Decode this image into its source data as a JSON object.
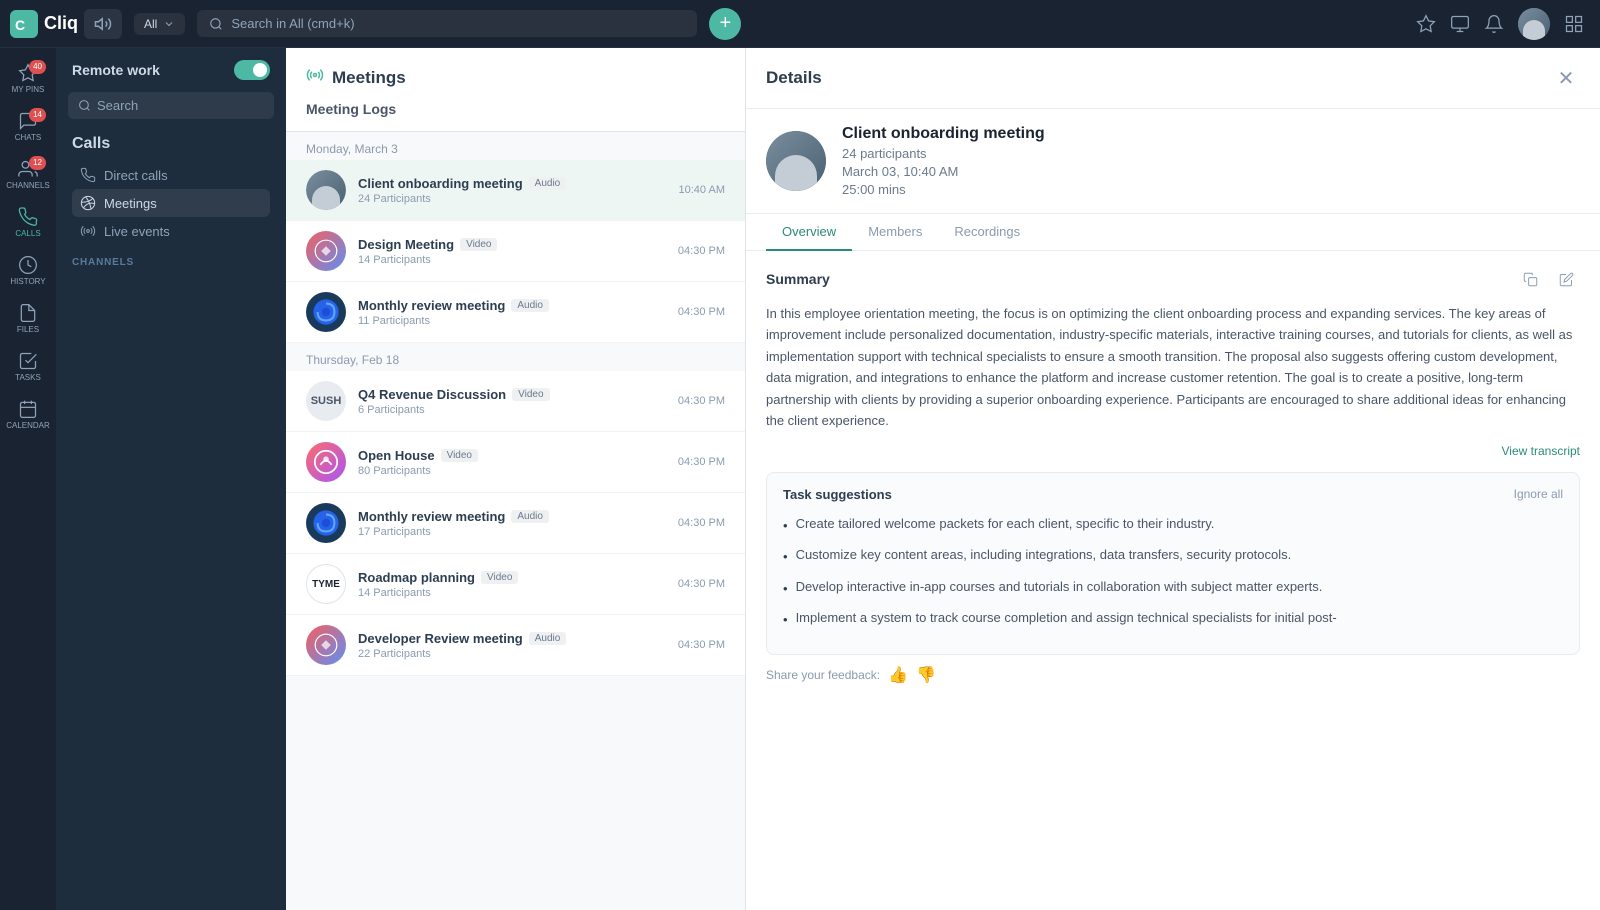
{
  "app": {
    "name": "Cliq",
    "workspace": "Remote work",
    "search_placeholder": "Search in All (cmd+k)",
    "all_label": "All"
  },
  "topbar": {
    "audio_label": "🔊",
    "add_btn": "+",
    "close_label": "×"
  },
  "sidebar": {
    "search_label": "Search",
    "calls_title": "Calls",
    "nav_items": [
      {
        "id": "direct-calls",
        "label": "Direct calls"
      },
      {
        "id": "meetings",
        "label": "Meetings"
      },
      {
        "id": "live-events",
        "label": "Live events"
      }
    ],
    "channels_label": "CHANNELS"
  },
  "icon_bar": {
    "items": [
      {
        "id": "my-pins",
        "label": "MY PINS",
        "badge": "40"
      },
      {
        "id": "chats",
        "label": "CHATS",
        "badge": "14"
      },
      {
        "id": "channels",
        "label": "CHANNELS",
        "badge": "12"
      },
      {
        "id": "calls",
        "label": "CALLS",
        "active": true
      },
      {
        "id": "history",
        "label": "HISTORY"
      },
      {
        "id": "files",
        "label": "FILES"
      },
      {
        "id": "tasks",
        "label": "TASKS"
      },
      {
        "id": "calendar",
        "label": "CALENDAR"
      }
    ]
  },
  "meetings_panel": {
    "title": "Meetings",
    "subtitle": "Meeting Logs",
    "dates": [
      {
        "label": "Monday, March 3",
        "meetings": [
          {
            "id": "client-onboarding",
            "name": "Client onboarding meeting",
            "tag": "Audio",
            "participants": "24 Participants",
            "time": "10:40 AM",
            "active": true
          },
          {
            "id": "design-meeting",
            "name": "Design Meeting",
            "tag": "Video",
            "participants": "14 Participants",
            "time": "04:30 PM"
          },
          {
            "id": "monthly-review-1",
            "name": "Monthly review meeting",
            "tag": "Audio",
            "participants": "11 Participants",
            "time": "04:30 PM"
          }
        ]
      },
      {
        "label": "Thursday, Feb 18",
        "meetings": [
          {
            "id": "q4-revenue",
            "name": "Q4 Revenue Discussion",
            "tag": "Video",
            "participants": "6 Participants",
            "time": "04:30 PM"
          },
          {
            "id": "open-house",
            "name": "Open House",
            "tag": "Video",
            "participants": "80 Participants",
            "time": "04:30 PM"
          },
          {
            "id": "monthly-review-2",
            "name": "Monthly review meeting",
            "tag": "Audio",
            "participants": "17 Participants",
            "time": "04:30 PM"
          },
          {
            "id": "roadmap-planning",
            "name": "Roadmap planning",
            "tag": "Video",
            "participants": "14 Participants",
            "time": "04:30 PM"
          },
          {
            "id": "developer-review",
            "name": "Developer Review meeting",
            "tag": "Audio",
            "participants": "22 Participants",
            "time": "04:30 PM"
          }
        ]
      }
    ]
  },
  "details_panel": {
    "title": "Details",
    "meeting_name": "Client onboarding meeting",
    "participants": "24 participants",
    "date": "March 03, 10:40 AM",
    "duration": "25:00 mins",
    "tabs": [
      {
        "id": "overview",
        "label": "Overview",
        "active": true
      },
      {
        "id": "members",
        "label": "Members"
      },
      {
        "id": "recordings",
        "label": "Recordings"
      }
    ],
    "summary_label": "Summary",
    "summary_text": "In this employee orientation meeting, the focus is on optimizing the client onboarding process and expanding services. The key areas of improvement include personalized documentation, industry-specific materials, interactive training courses, and tutorials for clients, as well as implementation support with technical specialists to ensure a smooth transition. The proposal also suggests offering custom development, data migration, and integrations to enhance the platform and increase customer retention. The goal is to create a positive, long-term partnership with clients by providing a superior onboarding experience. Participants are encouraged to share additional ideas for enhancing the client experience.",
    "view_transcript": "View transcript",
    "task_suggestions_title": "Task suggestions",
    "ignore_all_label": "Ignore all",
    "tasks": [
      "Create tailored welcome packets for each client, specific to their industry.",
      "Customize key content areas, including integrations, data transfers, security protocols.",
      "Develop interactive in-app courses and tutorials in collaboration with subject matter experts.",
      "Implement a system to track course completion and assign technical specialists for initial post-"
    ],
    "feedback_label": "Share your feedback:"
  }
}
